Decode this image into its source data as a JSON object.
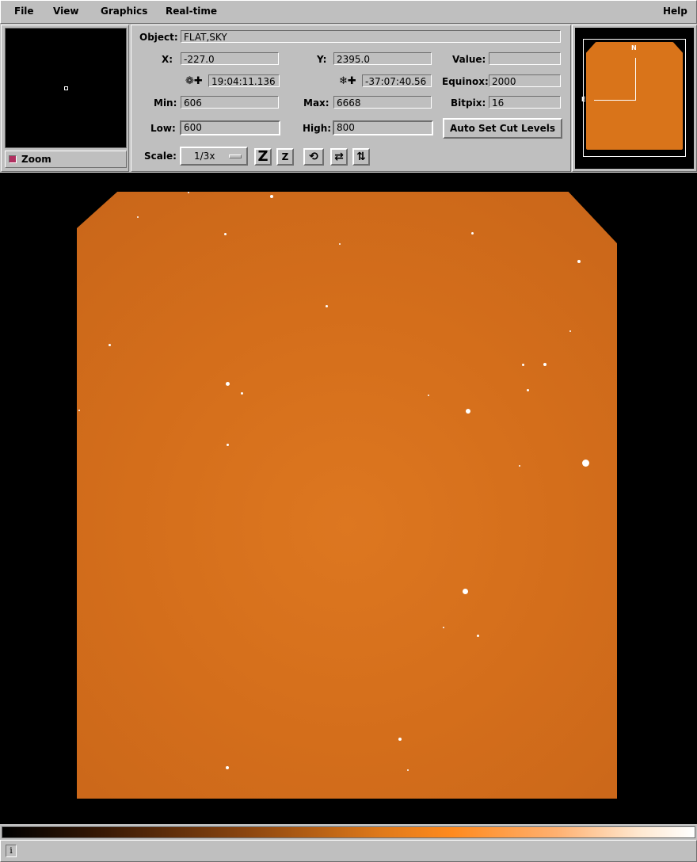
{
  "menu": {
    "file": "File",
    "view": "View",
    "graphics": "Graphics",
    "realtime": "Real-time",
    "help": "Help"
  },
  "zoom": {
    "label": "Zoom"
  },
  "info": {
    "object_label": "Object:",
    "object_value": "FLAT,SKY",
    "x_label": "X:",
    "x_value": "-227.0",
    "y_label": "Y:",
    "y_value": "2395.0",
    "value_label": "Value:",
    "value_value": "",
    "ra_value": "19:04:11.136",
    "dec_value": "-37:07:40.56",
    "equinox_label": "Equinox:",
    "equinox_value": "2000",
    "min_label": "Min:",
    "min_value": "606",
    "max_label": "Max:",
    "max_value": "6668",
    "bitpix_label": "Bitpix:",
    "bitpix_value": "16",
    "low_label": "Low:",
    "low_value": "600",
    "high_label": "High:",
    "high_value": "800",
    "autocut_label": "Auto Set Cut Levels",
    "scale_label": "Scale:",
    "scale_value": "1/3x"
  },
  "pan": {
    "north": "N",
    "east": "E"
  },
  "colors": {
    "image": "#d9741a",
    "panel": "#bfbfbf"
  },
  "icons": [
    "zoom-out-icon",
    "zoom-in-icon",
    "rotate-icon",
    "flip-x-icon",
    "flip-y-icon",
    "info-icon"
  ]
}
